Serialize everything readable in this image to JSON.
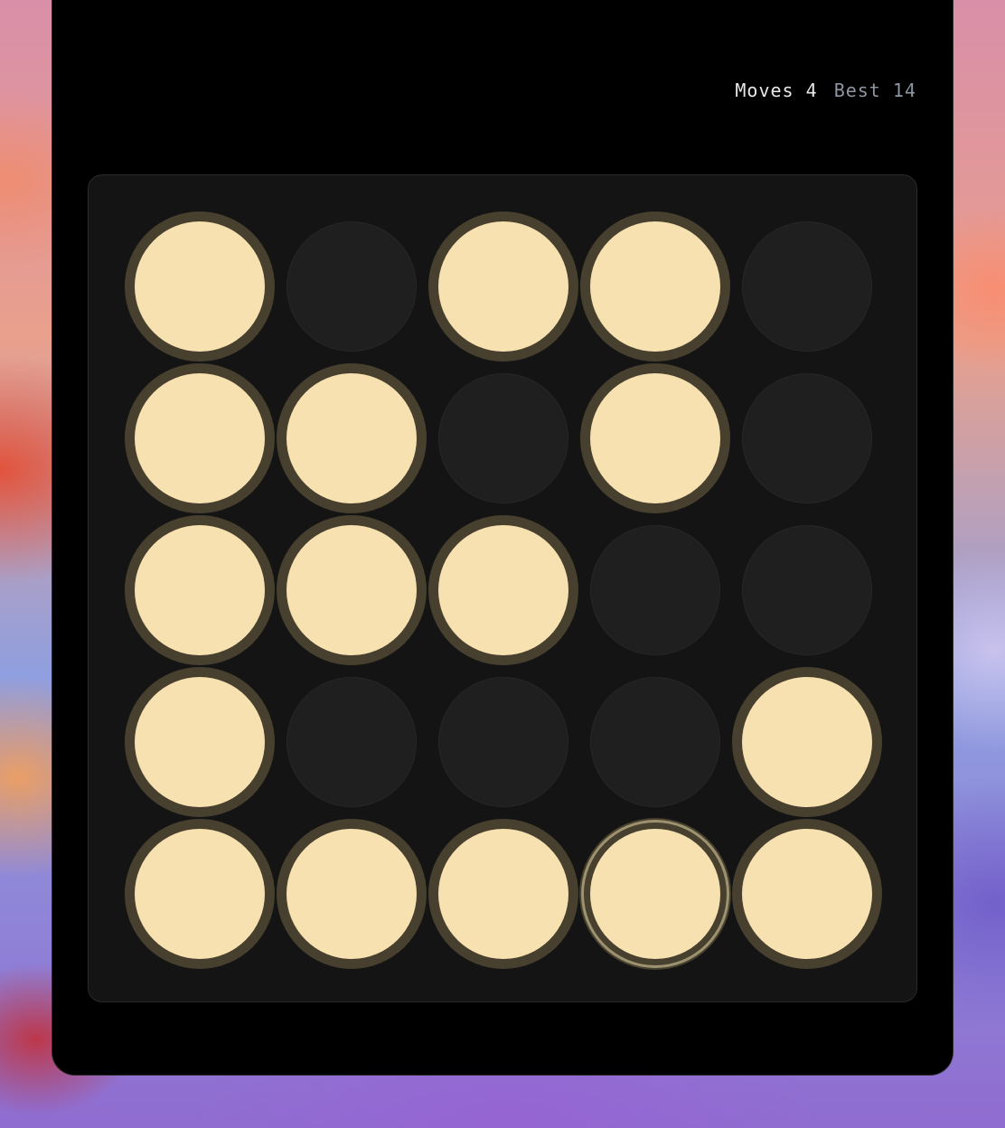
{
  "stats": {
    "moves_label": "Moves",
    "moves_value": 4,
    "best_label": "Best",
    "best_value": 14
  },
  "board": {
    "rows": 5,
    "cols": 5,
    "cells": [
      [
        true,
        false,
        true,
        true,
        false
      ],
      [
        true,
        true,
        false,
        true,
        false
      ],
      [
        true,
        true,
        true,
        false,
        false
      ],
      [
        true,
        false,
        false,
        false,
        true
      ],
      [
        true,
        true,
        true,
        true,
        true
      ]
    ],
    "selected": [
      4,
      3
    ]
  },
  "colors": {
    "light_on": "#f8e1b0",
    "light_ring": "#48402f",
    "light_off": "#1f1f1f",
    "board_bg": "#141414",
    "window_bg": "#000000"
  }
}
